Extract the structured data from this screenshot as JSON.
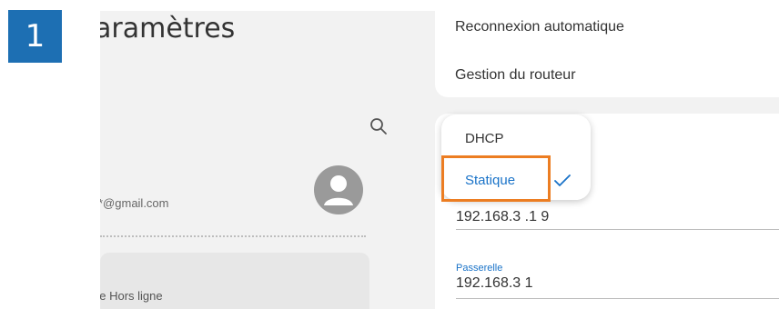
{
  "step": {
    "number": "1",
    "color": "#1d6fb3"
  },
  "left_panel": {
    "title": "aramètres",
    "search_icon": "search-icon",
    "email": "*@gmail.com",
    "avatar_icon": "avatar-icon",
    "offline_label": "de Hors ligne"
  },
  "router_settings": {
    "items": [
      {
        "label": "Reconnexion automatique"
      },
      {
        "label": "Gestion du routeur"
      }
    ]
  },
  "ip_settings": {
    "ip_value": "192.168.3 .1 9",
    "gateway_label": "Passerelle",
    "gateway_value": "192.168.3 1"
  },
  "dropdown": {
    "options": [
      {
        "label": "DHCP",
        "selected": false
      },
      {
        "label": "Statique",
        "selected": true
      }
    ],
    "check_icon": "checkmark-icon",
    "accent_color": "#1a73c8"
  },
  "highlight": {
    "color": "#ec7d22",
    "target": "Statique"
  }
}
